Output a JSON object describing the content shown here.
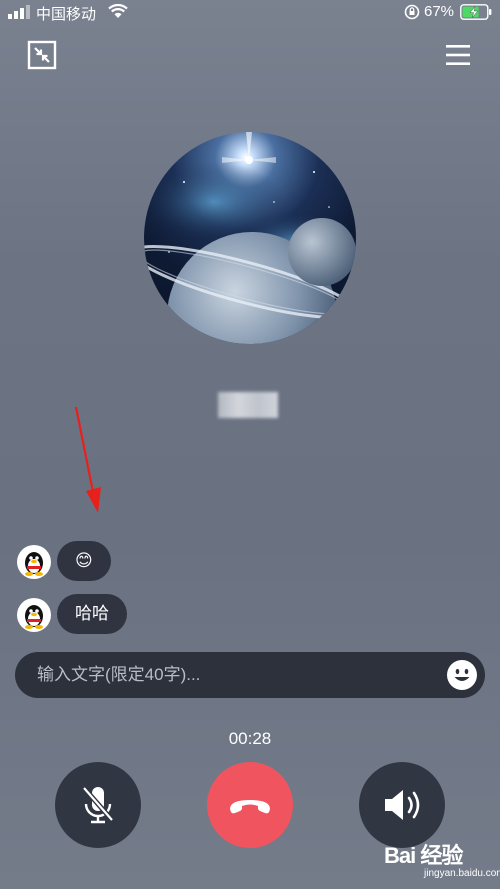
{
  "status_bar": {
    "carrier": "中国移动",
    "battery_percent": "67%"
  },
  "call": {
    "timer": "00:28"
  },
  "messages": [
    {
      "text": "😊"
    },
    {
      "text": "哈哈"
    }
  ],
  "input": {
    "placeholder": "输入文字(限定40字)..."
  },
  "watermark": {
    "logo": "Bai 经验",
    "url": "jingyan.baidu.com"
  },
  "colors": {
    "hangup": "#f0555f",
    "button_dark": "#313643",
    "annotation_arrow": "#e8201c"
  },
  "icons": {
    "collapse": "collapse-window-icon",
    "menu": "hamburger-menu-icon",
    "mute": "microphone-muted-icon",
    "hangup": "phone-hangup-icon",
    "speaker": "speaker-icon",
    "emoji": "smiley-icon"
  }
}
